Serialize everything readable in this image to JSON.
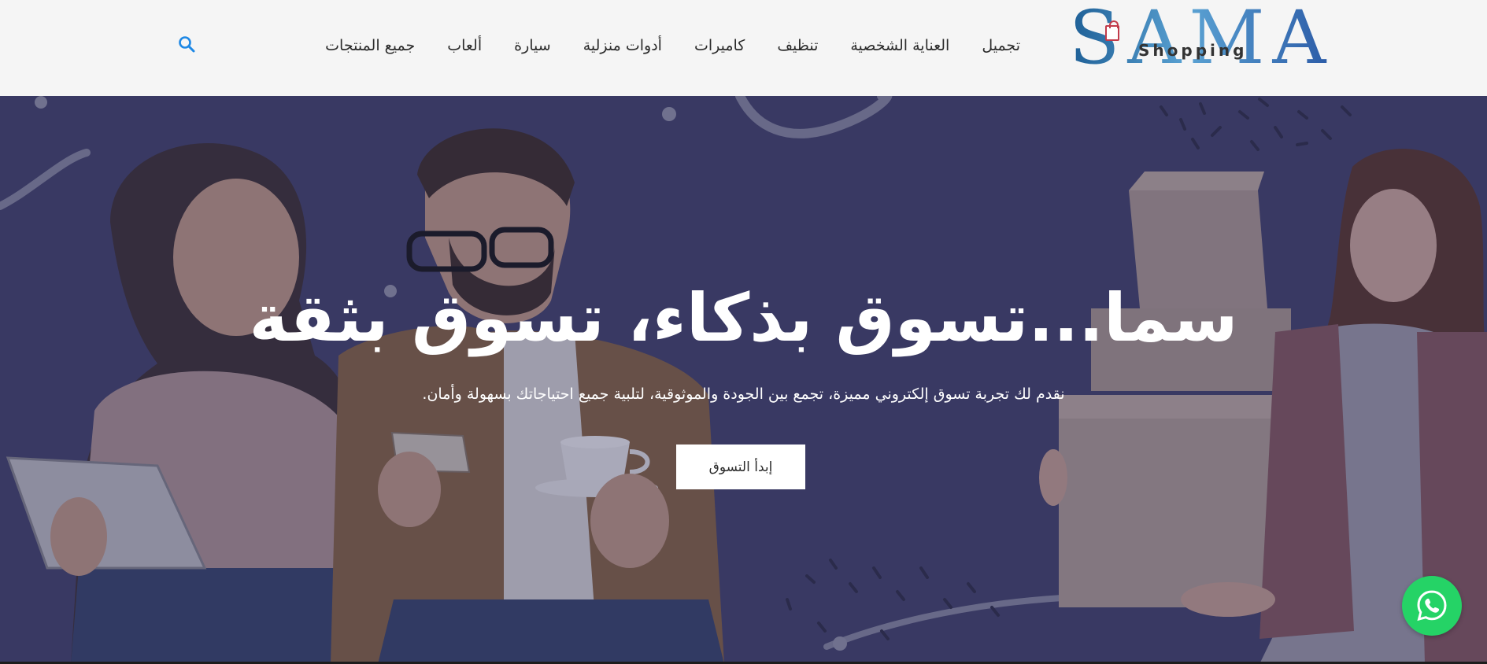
{
  "brand": {
    "logo_main": "SAMA",
    "logo_sub": "Shopping"
  },
  "nav": {
    "items": [
      {
        "label": "تجميل"
      },
      {
        "label": "العناية الشخصية"
      },
      {
        "label": "تنظيف"
      },
      {
        "label": "كاميرات"
      },
      {
        "label": "أدوات منزلية"
      },
      {
        "label": "سيارة"
      },
      {
        "label": "ألعاب"
      },
      {
        "label": "جميع المنتجات"
      }
    ],
    "search_icon": "search-icon"
  },
  "hero": {
    "title": "سما...تسوق بذكاء، تسوق بثقة",
    "subtitle": "نقدم لك تجربة تسوق إلكتروني مميزة، تجمع بين الجودة والموثوقية، لتلبية جميع احتياجاتك بسهولة وأمان.",
    "cta_label": "إبدأ التسوق"
  },
  "floating": {
    "whatsapp_icon": "whatsapp-icon"
  },
  "colors": {
    "header_bg": "#f5f5f5",
    "hero_bg": "#41426b",
    "link_blue": "#1e88e5",
    "whatsapp_green": "#25d366"
  }
}
